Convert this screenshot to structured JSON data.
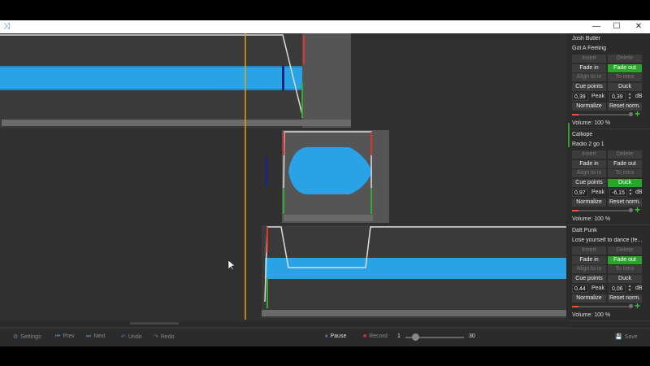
{
  "window": {
    "controls": {
      "minimize": "—",
      "maximize": "☐",
      "close": "✕"
    }
  },
  "tracks": [
    {
      "artist": "Josh Butler",
      "song": "Got A Feeling",
      "insert": "Insert",
      "delete": "Delete",
      "fade_in": "Fade in",
      "fade_out": "Fade out",
      "align_to_in": "Align to in",
      "to_intro": "To intro",
      "cue_points": "Cue points",
      "duck": "Duck",
      "value_left": "0,39",
      "peak_label": "Peak",
      "value_right": "0,39",
      "db_label": "dB",
      "normalize": "Normalize",
      "reset_norm": "Reset norm.",
      "volume": "Volume: 100 %",
      "fade_out_active": true,
      "duck_active": false
    },
    {
      "artist": "Calliope",
      "song": "Radio 2 go 1",
      "insert": "Insert",
      "delete": "Delete",
      "fade_in": "Fade in",
      "fade_out": "Fade out",
      "align_to_in": "Align to in",
      "to_intro": "To intro",
      "cue_points": "Cue points",
      "duck": "Duck",
      "value_left": "0,97",
      "peak_label": "Peak",
      "value_right": "-6,15",
      "db_label": "dB",
      "normalize": "Normalize",
      "reset_norm": "Reset norm.",
      "volume": "Volume: 100 %",
      "fade_out_active": false,
      "duck_active": true
    },
    {
      "artist": "Daft Punk",
      "song": "Lose yourself to dance (fe...",
      "insert": "Insert",
      "delete": "Delete",
      "fade_in": "Fade in",
      "fade_out": "Fade out",
      "align_to_in": "Align to in",
      "to_intro": "To intro",
      "cue_points": "Cue points",
      "duck": "Duck",
      "value_left": "0,44",
      "peak_label": "Peak",
      "value_right": "0,06",
      "db_label": "dB",
      "normalize": "Normalize",
      "reset_norm": "Reset norm.",
      "volume": "Volume: 100 %",
      "fade_out_active": true,
      "duck_active": false
    }
  ],
  "toolbar": {
    "settings": "Settings",
    "prev": "Prev",
    "next": "Next",
    "undo": "Undo",
    "redo": "Redo",
    "pause": "Pause",
    "record": "Record",
    "zoom_min": "1",
    "zoom_max": "30",
    "save": "Save"
  },
  "colors": {
    "waveform": "#1e90d6",
    "playhead": "#e0a020",
    "active_button": "#2aa52a",
    "cue_red": "#d33",
    "cue_green": "#3a3"
  }
}
